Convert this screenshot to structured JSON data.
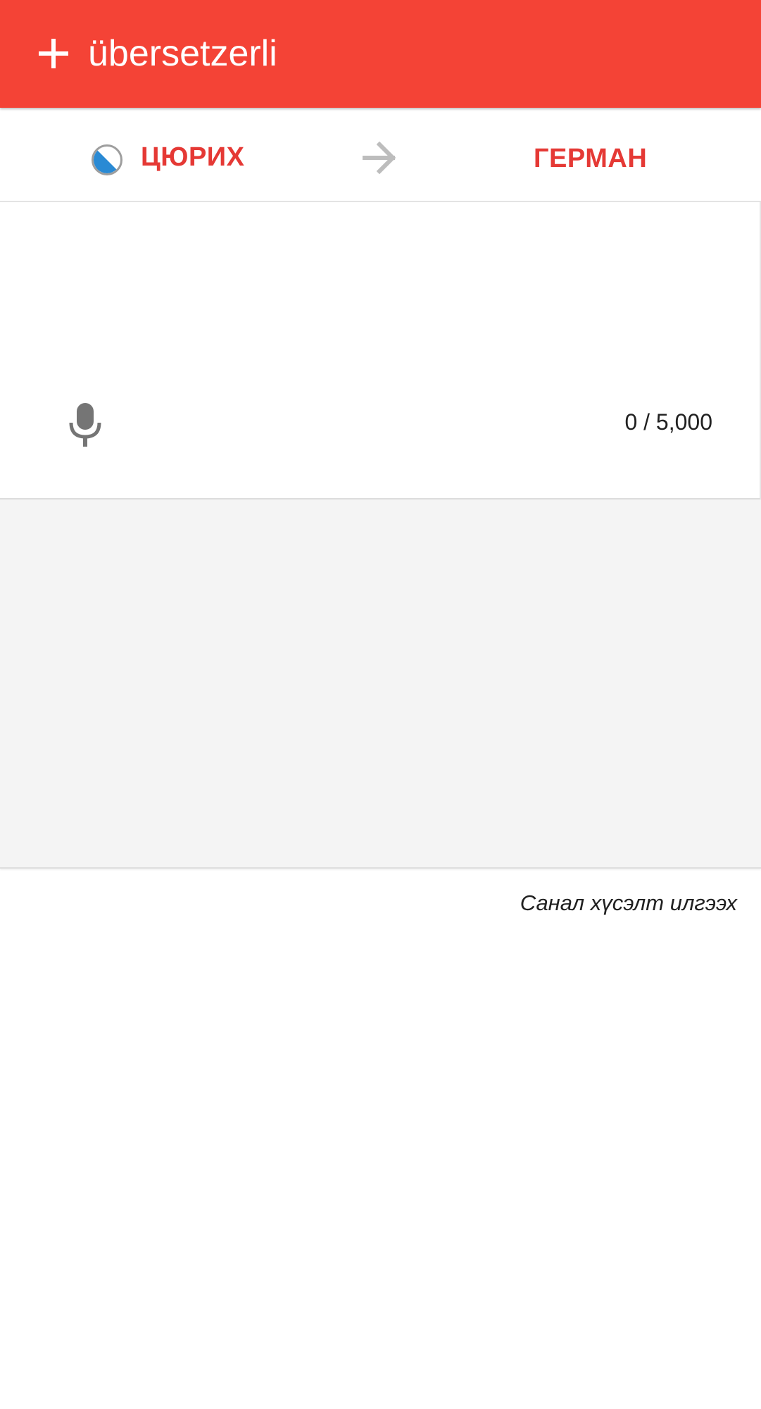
{
  "app_bar": {
    "title": "übersetzerli",
    "add_icon": "plus-icon",
    "background": "#f44336"
  },
  "language_bar": {
    "source_language": "ЦЮРИХ",
    "source_flag_icon": "zurich-flag-icon",
    "swap_icon": "arrow-right-icon",
    "target_language": "ГЕРМАН",
    "accent_color": "#e53935"
  },
  "input": {
    "value": "",
    "placeholder": "",
    "mic_icon": "microphone-icon",
    "char_counter": "0 / 5,000"
  },
  "output": {
    "text": ""
  },
  "footer": {
    "feedback_link": "Санал хүсэлт илгээх"
  }
}
